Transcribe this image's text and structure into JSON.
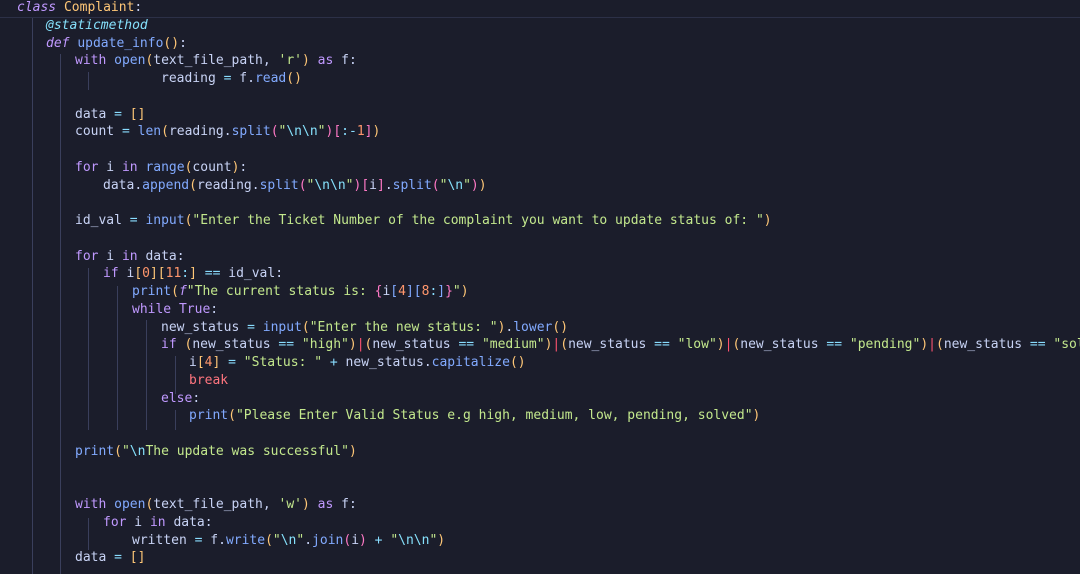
{
  "lines": [
    {
      "n": 1,
      "tokens": [
        [
          "kwi",
          "class"
        ],
        [
          "punc",
          " "
        ],
        [
          "cls",
          "Complaint"
        ],
        [
          "punc",
          ":"
        ]
      ]
    },
    {
      "n": 2,
      "tokens": [
        [
          "dec",
          "@staticmethod"
        ]
      ]
    },
    {
      "n": 3,
      "tokens": [
        [
          "kwi",
          "def"
        ],
        [
          "punc",
          " "
        ],
        [
          "fn",
          "update_info"
        ],
        [
          "br1",
          "()"
        ],
        [
          "punc",
          ":"
        ]
      ]
    },
    {
      "n": 4,
      "tokens": [
        [
          "kw",
          "with"
        ],
        [
          "punc",
          " "
        ],
        [
          "bi",
          "open"
        ],
        [
          "br1",
          "("
        ],
        [
          "var",
          "text_file_path"
        ],
        [
          "punc",
          ", "
        ],
        [
          "str",
          "'r'"
        ],
        [
          "br1",
          ")"
        ],
        [
          "punc",
          " "
        ],
        [
          "kw",
          "as"
        ],
        [
          "punc",
          " f:"
        ]
      ]
    },
    {
      "n": 5,
      "tokens": [
        [
          "var",
          "reading"
        ],
        [
          "punc",
          " "
        ],
        [
          "op",
          "="
        ],
        [
          "punc",
          " f."
        ],
        [
          "fn",
          "read"
        ],
        [
          "br1",
          "()"
        ]
      ]
    },
    {
      "n": 6,
      "tokens": []
    },
    {
      "n": 7,
      "tokens": [
        [
          "var",
          "data"
        ],
        [
          "punc",
          " "
        ],
        [
          "op",
          "="
        ],
        [
          "punc",
          " "
        ],
        [
          "br1",
          "[]"
        ]
      ]
    },
    {
      "n": 8,
      "tokens": [
        [
          "var",
          "count"
        ],
        [
          "punc",
          " "
        ],
        [
          "op",
          "="
        ],
        [
          "punc",
          " "
        ],
        [
          "bi",
          "len"
        ],
        [
          "br1",
          "("
        ],
        [
          "var",
          "reading"
        ],
        [
          "punc",
          "."
        ],
        [
          "fn",
          "split"
        ],
        [
          "br2",
          "("
        ],
        [
          "str",
          "\""
        ],
        [
          "esc",
          "\\n\\n"
        ],
        [
          "str",
          "\""
        ],
        [
          "br2",
          ")"
        ],
        [
          "br2",
          "["
        ],
        [
          "op",
          ":-"
        ],
        [
          "num",
          "1"
        ],
        [
          "br2",
          "]"
        ],
        [
          "br1",
          ")"
        ]
      ]
    },
    {
      "n": 9,
      "tokens": []
    },
    {
      "n": 10,
      "tokens": [
        [
          "kw",
          "for"
        ],
        [
          "punc",
          " i "
        ],
        [
          "kw",
          "in"
        ],
        [
          "punc",
          " "
        ],
        [
          "bi",
          "range"
        ],
        [
          "br1",
          "("
        ],
        [
          "var",
          "count"
        ],
        [
          "br1",
          ")"
        ],
        [
          "punc",
          ":"
        ]
      ]
    },
    {
      "n": 11,
      "tokens": [
        [
          "var",
          "data"
        ],
        [
          "punc",
          "."
        ],
        [
          "fn",
          "append"
        ],
        [
          "br1",
          "("
        ],
        [
          "var",
          "reading"
        ],
        [
          "punc",
          "."
        ],
        [
          "fn",
          "split"
        ],
        [
          "br2",
          "("
        ],
        [
          "str",
          "\""
        ],
        [
          "esc",
          "\\n\\n"
        ],
        [
          "str",
          "\""
        ],
        [
          "br2",
          ")"
        ],
        [
          "br2",
          "["
        ],
        [
          "var",
          "i"
        ],
        [
          "br2",
          "]"
        ],
        [
          "punc",
          "."
        ],
        [
          "fn",
          "split"
        ],
        [
          "br2",
          "("
        ],
        [
          "str",
          "\""
        ],
        [
          "esc",
          "\\n"
        ],
        [
          "str",
          "\""
        ],
        [
          "br2",
          ")"
        ],
        [
          "br1",
          ")"
        ]
      ]
    },
    {
      "n": 12,
      "tokens": []
    },
    {
      "n": 13,
      "tokens": [
        [
          "var",
          "id_val"
        ],
        [
          "punc",
          " "
        ],
        [
          "op",
          "="
        ],
        [
          "punc",
          " "
        ],
        [
          "bi",
          "input"
        ],
        [
          "br1",
          "("
        ],
        [
          "str",
          "\"Enter the Ticket Number of the complaint you want to update status of: \""
        ],
        [
          "br1",
          ")"
        ]
      ]
    },
    {
      "n": 14,
      "tokens": []
    },
    {
      "n": 15,
      "tokens": [
        [
          "kw",
          "for"
        ],
        [
          "punc",
          " i "
        ],
        [
          "kw",
          "in"
        ],
        [
          "punc",
          " data:"
        ]
      ]
    },
    {
      "n": 16,
      "tokens": [
        [
          "kw",
          "if"
        ],
        [
          "punc",
          " i"
        ],
        [
          "br1",
          "["
        ],
        [
          "num",
          "0"
        ],
        [
          "br1",
          "]["
        ],
        [
          "num",
          "11"
        ],
        [
          "op",
          ":"
        ],
        [
          "br1",
          "]"
        ],
        [
          "punc",
          " "
        ],
        [
          "op",
          "=="
        ],
        [
          "punc",
          " id_val:"
        ]
      ]
    },
    {
      "n": 17,
      "tokens": [
        [
          "fn",
          "print"
        ],
        [
          "br1",
          "("
        ],
        [
          "kwi",
          "f"
        ],
        [
          "str",
          "\"The current status is: "
        ],
        [
          "br2",
          "{"
        ],
        [
          "var",
          "i"
        ],
        [
          "br3",
          "["
        ],
        [
          "num",
          "4"
        ],
        [
          "br3",
          "]["
        ],
        [
          "num",
          "8"
        ],
        [
          "op",
          ":"
        ],
        [
          "br3",
          "]"
        ],
        [
          "br2",
          "}"
        ],
        [
          "str",
          "\""
        ],
        [
          "br1",
          ")"
        ]
      ]
    },
    {
      "n": 18,
      "tokens": [
        [
          "kw",
          "while"
        ],
        [
          "punc",
          " "
        ],
        [
          "kw",
          "True"
        ],
        [
          "punc",
          ":"
        ]
      ]
    },
    {
      "n": 19,
      "tokens": [
        [
          "var",
          "new_status"
        ],
        [
          "punc",
          " "
        ],
        [
          "op",
          "="
        ],
        [
          "punc",
          " "
        ],
        [
          "bi",
          "input"
        ],
        [
          "br1",
          "("
        ],
        [
          "str",
          "\"Enter the new status: \""
        ],
        [
          "br1",
          ")"
        ],
        [
          "punc",
          "."
        ],
        [
          "fn",
          "lower"
        ],
        [
          "br1",
          "()"
        ]
      ]
    },
    {
      "n": 20,
      "tokens": [
        [
          "kw",
          "if"
        ],
        [
          "punc",
          " "
        ],
        [
          "br1",
          "("
        ],
        [
          "var",
          "new_status"
        ],
        [
          "punc",
          " "
        ],
        [
          "op",
          "=="
        ],
        [
          "punc",
          " "
        ],
        [
          "str",
          "\"high\""
        ],
        [
          "br1",
          ")"
        ],
        [
          "red",
          "|"
        ],
        [
          "br1",
          "("
        ],
        [
          "var",
          "new_status"
        ],
        [
          "punc",
          " "
        ],
        [
          "op",
          "=="
        ],
        [
          "punc",
          " "
        ],
        [
          "str",
          "\"medium\""
        ],
        [
          "br1",
          ")"
        ],
        [
          "red",
          "|"
        ],
        [
          "br1",
          "("
        ],
        [
          "var",
          "new_status"
        ],
        [
          "punc",
          " "
        ],
        [
          "op",
          "=="
        ],
        [
          "punc",
          " "
        ],
        [
          "str",
          "\"low\""
        ],
        [
          "br1",
          ")"
        ],
        [
          "red",
          "|"
        ],
        [
          "br1",
          "("
        ],
        [
          "var",
          "new_status"
        ],
        [
          "punc",
          " "
        ],
        [
          "op",
          "=="
        ],
        [
          "punc",
          " "
        ],
        [
          "str",
          "\"pending\""
        ],
        [
          "br1",
          ")"
        ],
        [
          "red",
          "|"
        ],
        [
          "br1",
          "("
        ],
        [
          "var",
          "new_status"
        ],
        [
          "punc",
          " "
        ],
        [
          "op",
          "=="
        ],
        [
          "punc",
          " "
        ],
        [
          "str",
          "\"solved\""
        ],
        [
          "br1",
          ")"
        ],
        [
          "punc",
          ":"
        ]
      ]
    },
    {
      "n": 21,
      "tokens": [
        [
          "var",
          "i"
        ],
        [
          "br1",
          "["
        ],
        [
          "num",
          "4"
        ],
        [
          "br1",
          "]"
        ],
        [
          "punc",
          " "
        ],
        [
          "op",
          "="
        ],
        [
          "punc",
          " "
        ],
        [
          "str",
          "\"Status: \""
        ],
        [
          "punc",
          " "
        ],
        [
          "op",
          "+"
        ],
        [
          "punc",
          " new_status."
        ],
        [
          "fn",
          "capitalize"
        ],
        [
          "br1",
          "()"
        ]
      ]
    },
    {
      "n": 22,
      "tokens": [
        [
          "ctrl",
          "break"
        ]
      ]
    },
    {
      "n": 23,
      "tokens": [
        [
          "kw",
          "else"
        ],
        [
          "punc",
          ":"
        ]
      ]
    },
    {
      "n": 24,
      "tokens": [
        [
          "fn",
          "print"
        ],
        [
          "br1",
          "("
        ],
        [
          "str",
          "\"Please Enter Valid Status e.g high, medium, low, pending, solved\""
        ],
        [
          "br1",
          ")"
        ]
      ]
    },
    {
      "n": 25,
      "tokens": []
    },
    {
      "n": 26,
      "tokens": [
        [
          "fn",
          "print"
        ],
        [
          "br1",
          "("
        ],
        [
          "str",
          "\""
        ],
        [
          "esc",
          "\\n"
        ],
        [
          "str",
          "The update was successful\""
        ],
        [
          "br1",
          ")"
        ]
      ]
    },
    {
      "n": 27,
      "tokens": []
    },
    {
      "n": 28,
      "tokens": []
    },
    {
      "n": 29,
      "tokens": [
        [
          "kw",
          "with"
        ],
        [
          "punc",
          " "
        ],
        [
          "bi",
          "open"
        ],
        [
          "br1",
          "("
        ],
        [
          "var",
          "text_file_path"
        ],
        [
          "punc",
          ", "
        ],
        [
          "str",
          "'w'"
        ],
        [
          "br1",
          ")"
        ],
        [
          "punc",
          " "
        ],
        [
          "kw",
          "as"
        ],
        [
          "punc",
          " f:"
        ]
      ]
    },
    {
      "n": 30,
      "tokens": [
        [
          "kw",
          "for"
        ],
        [
          "punc",
          " i "
        ],
        [
          "kw",
          "in"
        ],
        [
          "punc",
          " data:"
        ]
      ]
    },
    {
      "n": 31,
      "tokens": [
        [
          "var",
          "written"
        ],
        [
          "punc",
          " "
        ],
        [
          "op",
          "="
        ],
        [
          "punc",
          " f."
        ],
        [
          "fn",
          "write"
        ],
        [
          "br1",
          "("
        ],
        [
          "str",
          "\""
        ],
        [
          "esc",
          "\\n"
        ],
        [
          "str",
          "\""
        ],
        [
          "punc",
          "."
        ],
        [
          "fn",
          "join"
        ],
        [
          "br2",
          "("
        ],
        [
          "var",
          "i"
        ],
        [
          "br2",
          ")"
        ],
        [
          "punc",
          " "
        ],
        [
          "op",
          "+"
        ],
        [
          "punc",
          " "
        ],
        [
          "str",
          "\""
        ],
        [
          "esc",
          "\\n\\n"
        ],
        [
          "str",
          "\""
        ],
        [
          "br1",
          ")"
        ]
      ]
    },
    {
      "n": 32,
      "tokens": [
        [
          "var",
          "data"
        ],
        [
          "punc",
          " "
        ],
        [
          "op",
          "="
        ],
        [
          "punc",
          " "
        ],
        [
          "br1",
          "[]"
        ]
      ]
    }
  ]
}
